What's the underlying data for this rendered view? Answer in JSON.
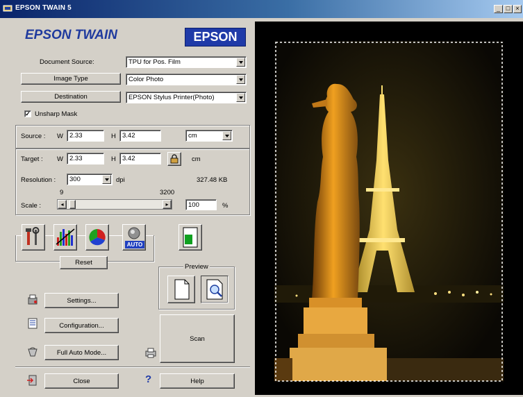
{
  "window": {
    "title": "EPSON TWAIN 5",
    "minimize": "_",
    "maximize": "□",
    "close": "×"
  },
  "header": {
    "app_title": "EPSON TWAIN",
    "logo": "EPSON"
  },
  "source_settings": {
    "document_source_label": "Document Source:",
    "document_source_value": "TPU for Pos. Film",
    "image_type_button": "Image Type",
    "image_type_value": "Color Photo",
    "destination_button": "Destination",
    "destination_value": "EPSON Stylus Printer(Photo)",
    "unsharp_mask_label": "Unsharp Mask",
    "unsharp_mask_checked": "✓"
  },
  "source_size": {
    "label": "Source :",
    "w_label": "W",
    "w_value": "2.33",
    "h_label": "H",
    "h_value": "3.42",
    "unit": "cm"
  },
  "target_size": {
    "label": "Target :",
    "w_label": "W",
    "w_value": "2.33",
    "h_label": "H",
    "h_value": "3.42",
    "unit": "cm",
    "resolution_label": "Resolution :",
    "resolution_value": "300",
    "resolution_unit": "dpi",
    "file_size": "327.48 KB",
    "scale_label": "Scale :",
    "scale_min": "9",
    "scale_max": "3200",
    "scale_value": "100",
    "scale_unit": "%"
  },
  "tools": {
    "reset_button": "Reset",
    "auto_label": "AUTO"
  },
  "preview_group": {
    "label": "Preview"
  },
  "buttons": {
    "settings": "Settings...",
    "configuration": "Configuration...",
    "full_auto": "Full Auto Mode...",
    "scan": "Scan",
    "close": "Close",
    "help": "Help",
    "help_glyph": "?"
  },
  "colors": {
    "title_blue": "#1f3a9e",
    "logo_bg": "#1f3aa8",
    "face": "#d4d0c8"
  }
}
